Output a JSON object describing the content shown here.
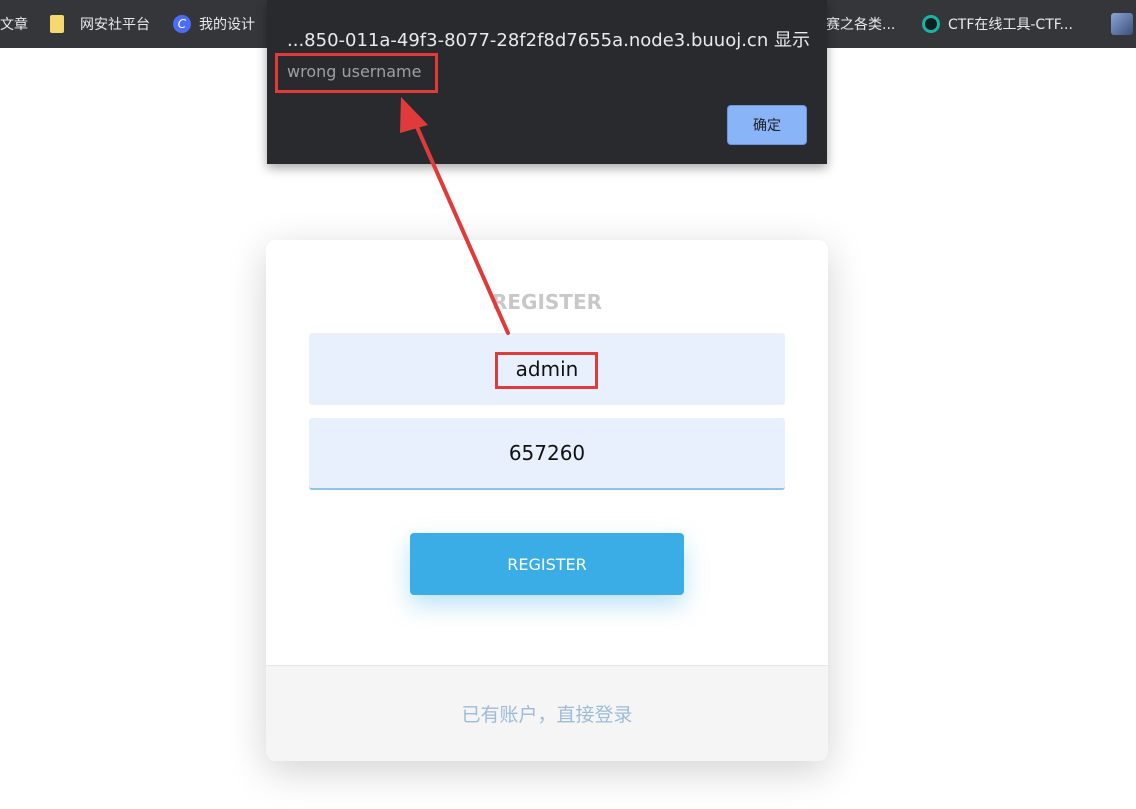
{
  "bookmarks": [
    {
      "label": "文章",
      "icon": "none"
    },
    {
      "label": "网安社平台",
      "icon": "folder-icon"
    },
    {
      "label": "我的设计",
      "icon": "c-logo-icon"
    },
    {
      "label": "赛之各类...",
      "icon": "none"
    },
    {
      "label": "CTF在线工具-CTF...",
      "icon": "tool-icon"
    },
    {
      "label": "",
      "icon": "site-icon"
    }
  ],
  "alert": {
    "title": "...850-011a-49f3-8077-28f2f8d7655a.node3.buuoj.cn 显示",
    "message": "wrong username",
    "ok_label": "确定"
  },
  "form": {
    "title": "REGISTER",
    "username": "admin",
    "password": "657260",
    "submit_label": "REGISTER",
    "login_link": "已有账户，直接登录"
  },
  "colors": {
    "annotation": "#e03a3a",
    "accent": "#3aade6"
  }
}
